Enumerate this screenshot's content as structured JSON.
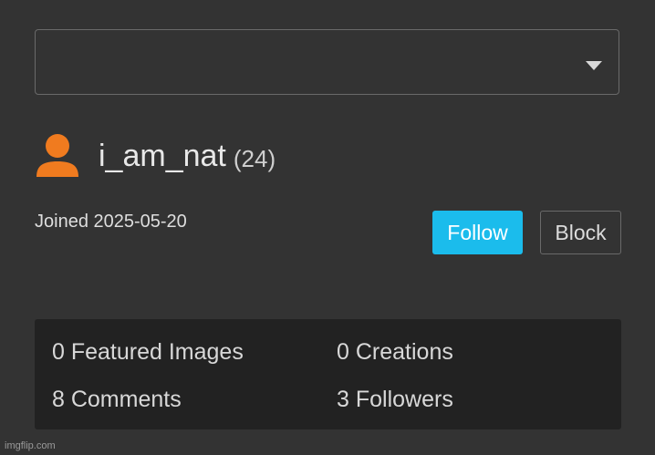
{
  "dropdown": {
    "selected": ""
  },
  "user": {
    "username": "i_am_nat",
    "points": "(24)",
    "joined": "Joined 2025-05-20"
  },
  "actions": {
    "follow_label": "Follow",
    "block_label": "Block"
  },
  "stats": {
    "featured": "0 Featured Images",
    "creations": "0 Creations",
    "comments": "8 Comments",
    "followers": "3 Followers"
  },
  "watermark": "imgflip.com",
  "colors": {
    "background": "#333333",
    "panel": "#222222",
    "accent": "#1bbcec",
    "avatar": "#f07b1f"
  },
  "icons": {
    "avatar": "user-silhouette-icon",
    "dropdown": "caret-down-icon"
  }
}
